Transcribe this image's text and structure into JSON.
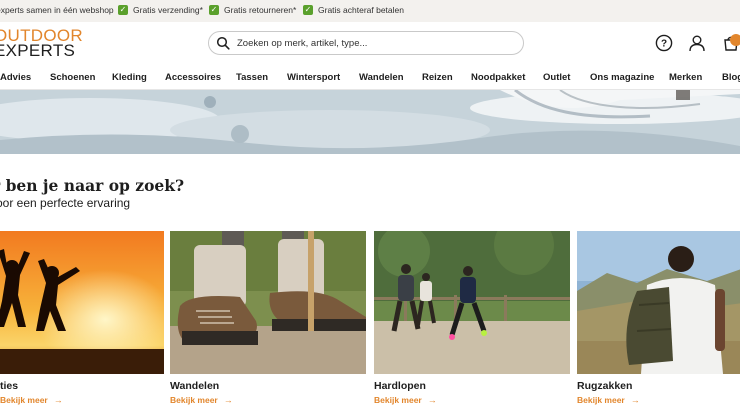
{
  "usp_bar": {
    "items": [
      {
        "label": "experts samen in één webshop",
        "has_check": false
      },
      {
        "label": "Gratis verzending*",
        "has_check": true
      },
      {
        "label": "Gratis retourneren*",
        "has_check": true
      },
      {
        "label": "Gratis achteraf betalen",
        "has_check": true
      }
    ]
  },
  "header": {
    "logo_line1": "OUTDOOR",
    "logo_line2": "EXPERTS",
    "search_placeholder": "Zoeken op merk, artikel, type...",
    "icons": [
      "help-icon",
      "account-icon",
      "cart-icon"
    ]
  },
  "nav": {
    "items": [
      "Advies",
      "Schoenen",
      "Kleding",
      "Accessoires",
      "Tassen",
      "Wintersport",
      "Wandelen",
      "Reizen",
      "Noodpakket",
      "Outlet",
      "Ons magazine",
      "Merken",
      "Blog"
    ]
  },
  "section": {
    "title": "r ben je naar op zoek?",
    "subtitle": "oor een perfecte ervaring"
  },
  "categories": [
    {
      "name": "ties",
      "link": "Bekijk meer"
    },
    {
      "name": "Wandelen",
      "link": "Bekijk meer"
    },
    {
      "name": "Hardlopen",
      "link": "Bekijk meer"
    },
    {
      "name": "Rugzakken",
      "link": "Bekijk meer"
    }
  ],
  "colors": {
    "accent": "#e2862c",
    "check_green": "#5aa02c",
    "usp_bg": "#f3f1ee"
  }
}
